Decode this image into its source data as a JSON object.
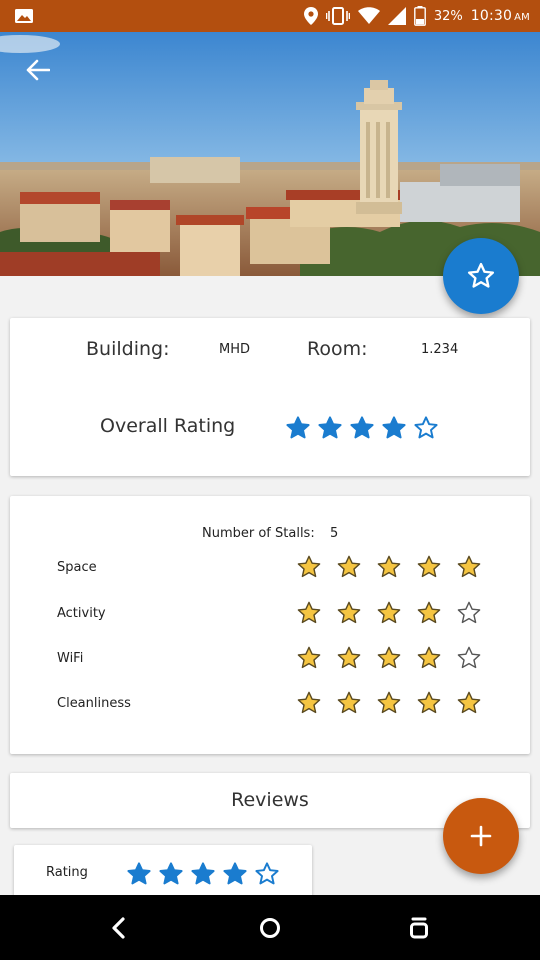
{
  "status_bar": {
    "battery": "32%",
    "time": "10:30",
    "ampm": "AM",
    "icons": [
      "image-icon",
      "location-icon",
      "vibrate-icon",
      "wifi-icon",
      "signal-icon",
      "battery-icon"
    ]
  },
  "header": {
    "back_icon": "arrow-left-icon",
    "favorite_icon": "star-outline-icon"
  },
  "info": {
    "building_label": "Building:",
    "building_value": "MHD",
    "room_label": "Room:",
    "room_value": "1.234",
    "overall_label": "Overall Rating",
    "overall_rating": 4,
    "overall_max": 5
  },
  "ratings": {
    "stalls_label": "Number of Stalls:",
    "stalls_value": "5",
    "rows": [
      {
        "label": "Space",
        "value": 5
      },
      {
        "label": "Activity",
        "value": 4
      },
      {
        "label": "WiFi",
        "value": 4
      },
      {
        "label": "Cleanliness",
        "value": 5
      }
    ],
    "max": 5
  },
  "reviews": {
    "title": "Reviews",
    "add_icon": "plus-icon",
    "items": [
      {
        "rating_label": "Rating",
        "rating": 4
      }
    ]
  },
  "colors": {
    "status_bar": "#b34f0f",
    "accent_blue": "#1a7ccf",
    "accent_orange": "#c8590f",
    "star_yellow": "#f5c542"
  }
}
